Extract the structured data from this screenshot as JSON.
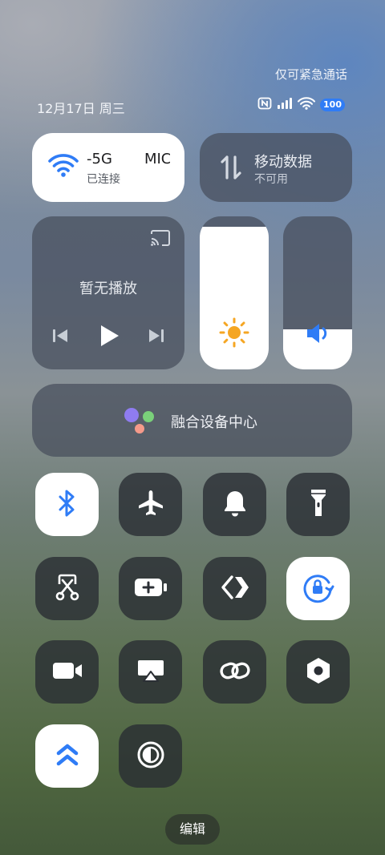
{
  "status_bar": {
    "emergency_text": "仅可紧急通话",
    "date": "12月17日 周三",
    "battery_level": "100",
    "icons": [
      "nfc-icon",
      "cellular-signal-icon",
      "wifi-icon"
    ]
  },
  "wifi": {
    "name": "-5G       MIC",
    "status": "已连接",
    "accent": "#2f7cf6"
  },
  "mobile_data": {
    "label": "移动数据",
    "status": "不可用"
  },
  "media": {
    "title": "暂无播放"
  },
  "brightness": {
    "level": 0.93
  },
  "volume": {
    "level": 0.26
  },
  "device_center": {
    "label": "融合设备中心"
  },
  "toggles": [
    {
      "name": "bluetooth",
      "icon": "bluetooth-icon",
      "active": true
    },
    {
      "name": "airplane-mode",
      "icon": "airplane-icon",
      "active": false
    },
    {
      "name": "ringer",
      "icon": "bell-icon",
      "active": false
    },
    {
      "name": "flashlight",
      "icon": "flashlight-icon",
      "active": false
    },
    {
      "name": "screenshot",
      "icon": "scissors-icon",
      "active": false
    },
    {
      "name": "battery-saver",
      "icon": "battery-plus-icon",
      "active": false
    },
    {
      "name": "nearby-share",
      "icon": "share-chevrons-icon",
      "active": false
    },
    {
      "name": "rotation-lock",
      "icon": "rotation-lock-icon",
      "active": true
    },
    {
      "name": "screen-record",
      "icon": "video-camera-icon",
      "active": false
    },
    {
      "name": "screen-cast",
      "icon": "airplay-icon",
      "active": false
    },
    {
      "name": "link",
      "icon": "link-icon",
      "active": false
    },
    {
      "name": "settings",
      "icon": "hexagon-nut-icon",
      "active": false
    },
    {
      "name": "double-up",
      "icon": "double-chevron-up-icon",
      "active": true
    },
    {
      "name": "dark-mode",
      "icon": "contrast-icon",
      "active": false
    }
  ],
  "edit_button": {
    "label": "编辑"
  }
}
